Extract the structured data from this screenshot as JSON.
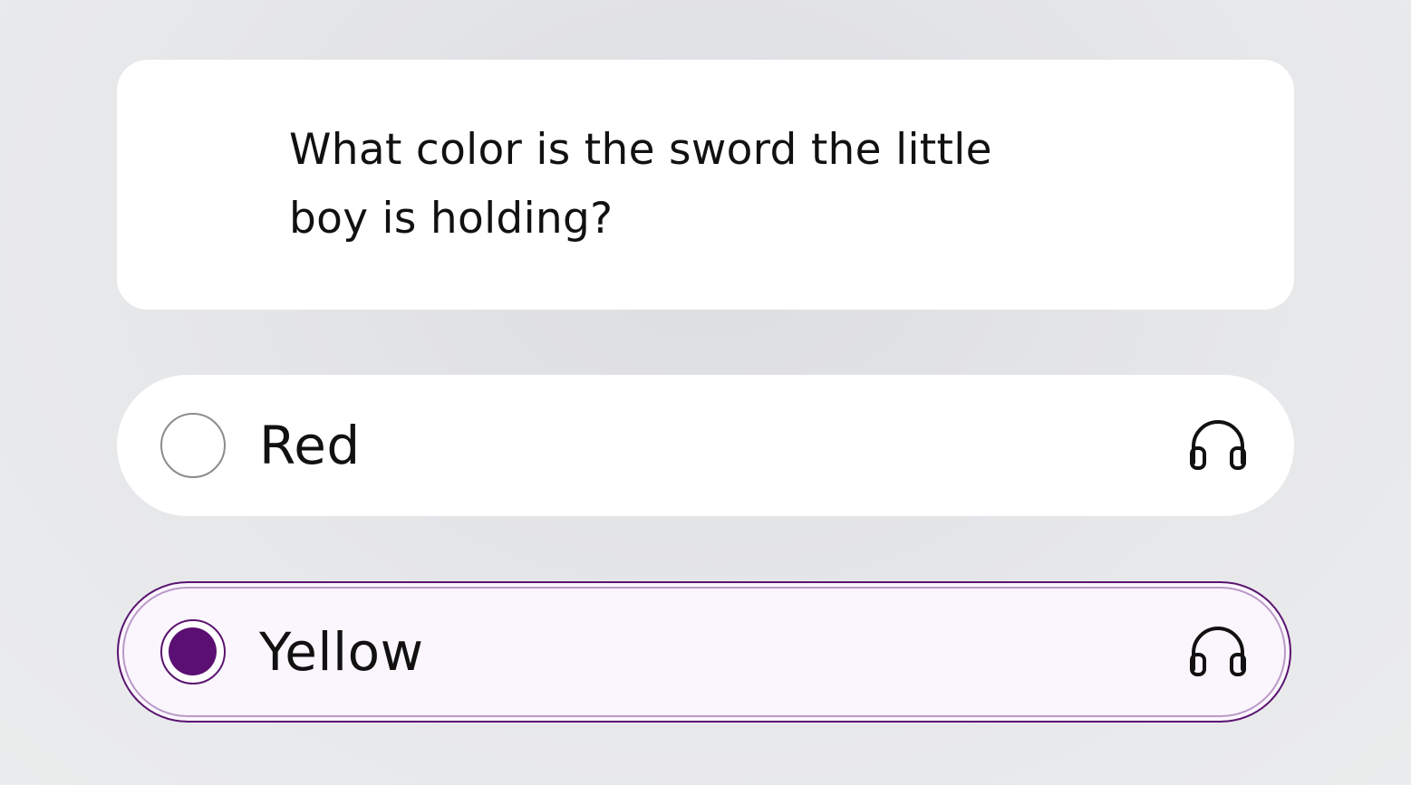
{
  "question": {
    "text": "What color is the sword the little boy is holding?"
  },
  "options": [
    {
      "label": "Red",
      "selected": false,
      "icon": "headphones-icon"
    },
    {
      "label": "Yellow",
      "selected": true,
      "icon": "headphones-icon"
    }
  ],
  "colors": {
    "accent": "#5b0f73",
    "selected_background": "#fbf6fd",
    "radio_unselected_border": "#8d8a90",
    "card_background": "#ffffff",
    "page_background": "#e6e7e9",
    "text": "#111111"
  }
}
